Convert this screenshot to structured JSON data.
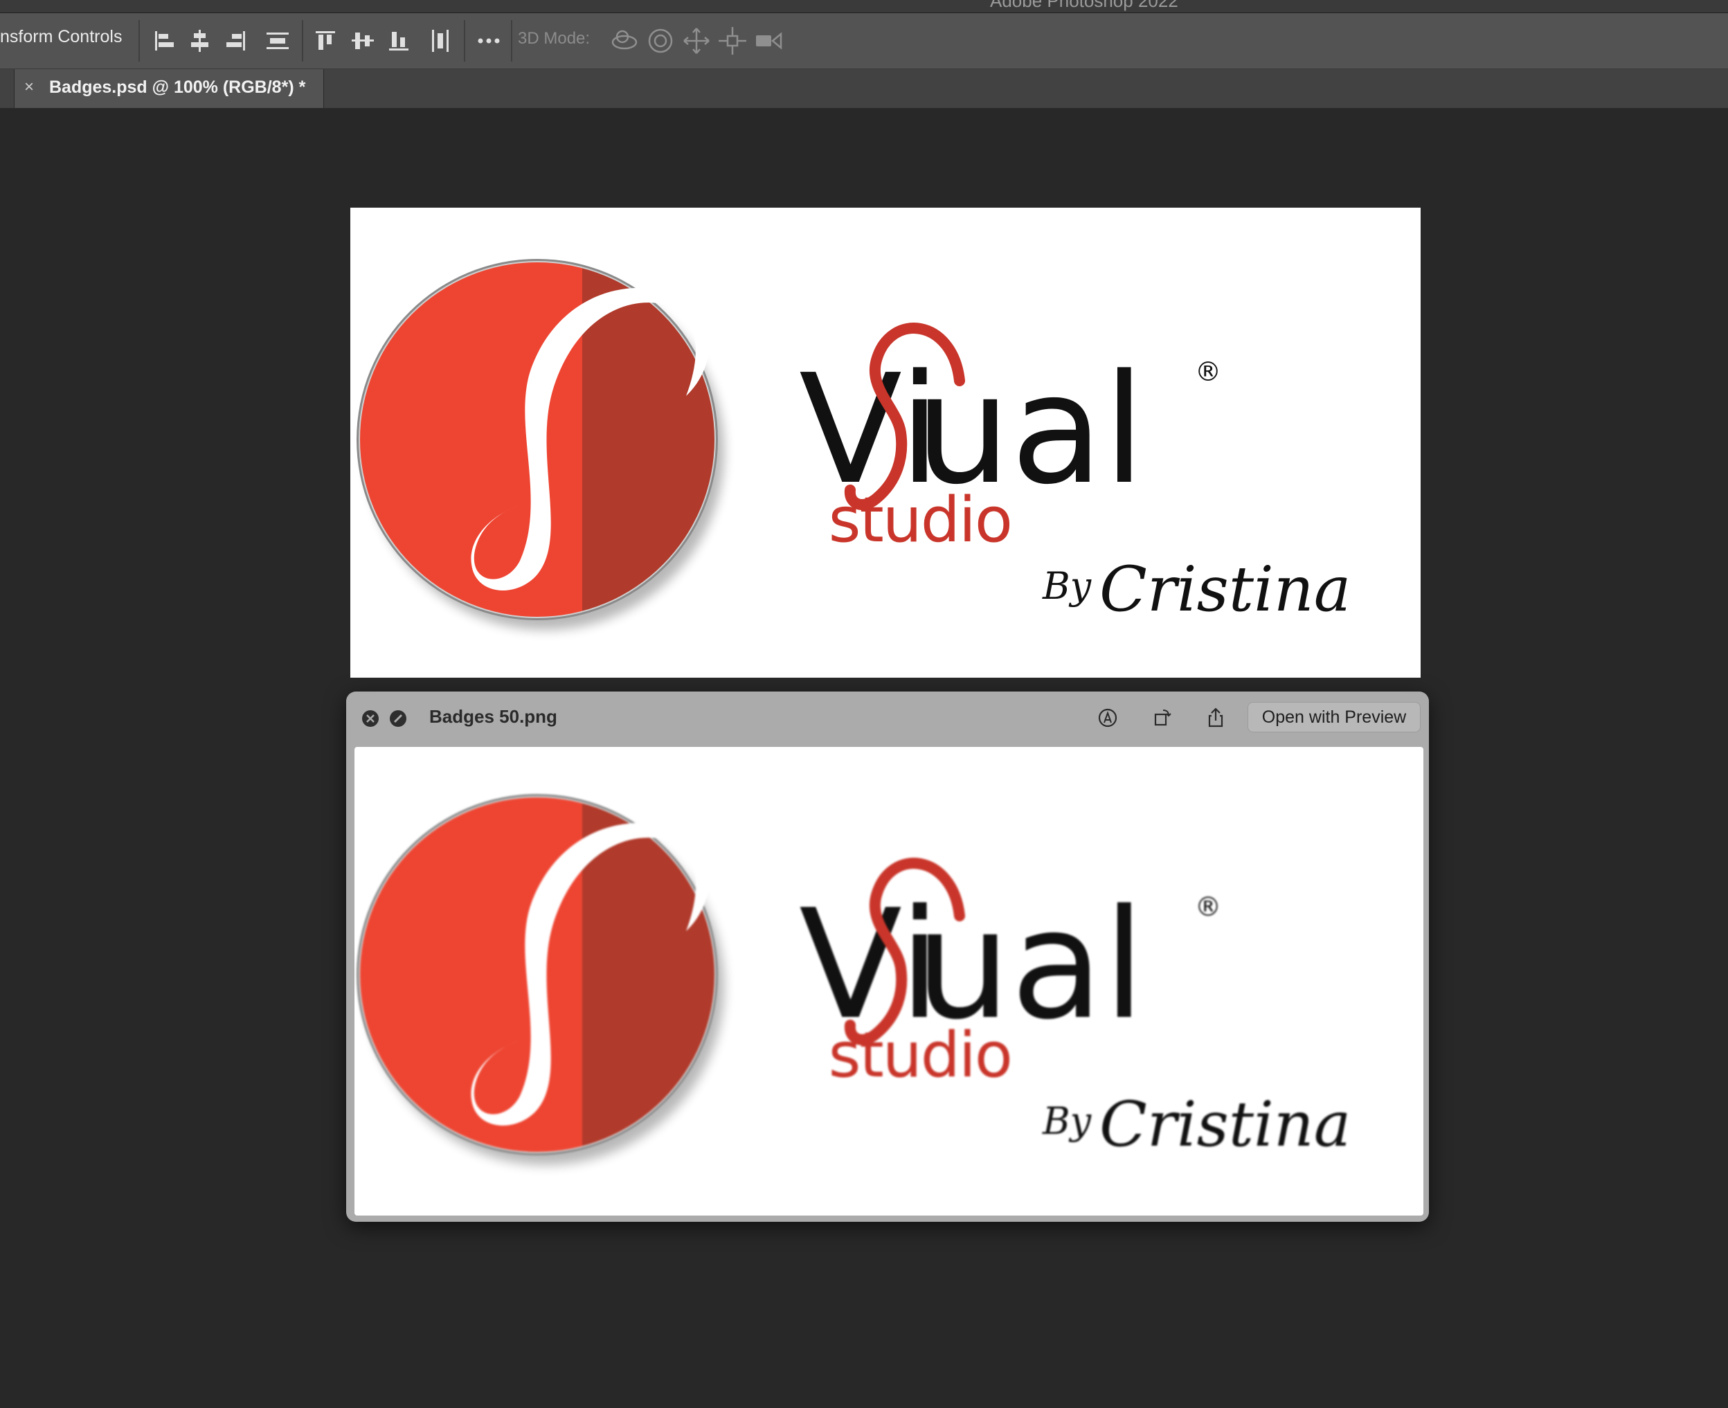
{
  "app": {
    "window_title": "Adobe Photoshop 2022"
  },
  "options_bar": {
    "transform_label": "nsform Controls",
    "mode_label": "3D Mode:"
  },
  "document_tab": {
    "close_glyph": "×",
    "title": "Badges.psd @ 100% (RGB/8*) *"
  },
  "logo": {
    "word_pre": "Vi",
    "word_post": "ual",
    "registered": "®",
    "subtitle": "studio",
    "signature_by": "By",
    "signature_name": "Cristina",
    "colors": {
      "badge_left": "#ee4532",
      "badge_right": "#b03a2b",
      "swash": "#ffffff",
      "script_red": "#c9352a",
      "ink": "#111111"
    }
  },
  "quick_look": {
    "filename": "Badges 50.png",
    "open_button": "Open with Preview"
  },
  "icons": [
    "align-left-icon",
    "align-center-h-icon",
    "align-right-icon",
    "distribute-h-icon",
    "align-top-icon",
    "align-middle-v-icon",
    "align-bottom-icon",
    "distribute-v-icon",
    "more-icon",
    "orbit-3d-icon",
    "roll-3d-icon",
    "pan-3d-icon",
    "slide-3d-icon",
    "scale-3d-icon",
    "close-icon",
    "fullscreen-icon",
    "markup-icon",
    "rotate-icon",
    "share-icon"
  ]
}
